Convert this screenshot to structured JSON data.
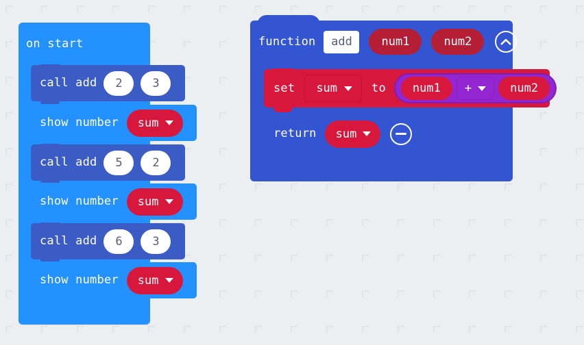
{
  "workspace": {
    "background_color": "#eceff1",
    "grid_mark_color": "#dde2e5"
  },
  "palette": {
    "event_blue": "#2391ff",
    "function_call_blue": "#3b5bc5",
    "function_def_blue": "#3455d1",
    "variable_red": "#d7183c",
    "parameter_dark_red": "#b41f35",
    "operator_purple": "#9326d1",
    "field_white": "#ffffff",
    "field_text": "#575e75"
  },
  "on_start_script": {
    "hat_label": "on start",
    "statements": [
      {
        "kind": "call",
        "label": "call add",
        "args": [
          "2",
          "3"
        ]
      },
      {
        "kind": "show",
        "label": "show number",
        "variable": "sum",
        "dropdown_icon": "chevron-down-icon"
      },
      {
        "kind": "call",
        "label": "call add",
        "args": [
          "5",
          "2"
        ]
      },
      {
        "kind": "show",
        "label": "show number",
        "variable": "sum",
        "dropdown_icon": "chevron-down-icon"
      },
      {
        "kind": "call",
        "label": "call add",
        "args": [
          "6",
          "3"
        ]
      },
      {
        "kind": "show",
        "label": "show number",
        "variable": "sum",
        "dropdown_icon": "chevron-down-icon"
      }
    ]
  },
  "function_definition": {
    "keyword": "function",
    "name": "add",
    "parameters": [
      "num1",
      "num2"
    ],
    "collapse_icon": "chevron-up-circle-icon",
    "body": {
      "set_statement": {
        "keyword": "set",
        "variable": "sum",
        "variable_dropdown_icon": "chevron-down-icon",
        "connector": "to",
        "expression": {
          "left_operand": "num1",
          "operator": "+",
          "operator_dropdown_icon": "chevron-down-icon",
          "right_operand": "num2"
        }
      },
      "return_statement": {
        "keyword": "return",
        "variable": "sum",
        "variable_dropdown_icon": "chevron-down-icon",
        "remove_icon": "minus-circle-icon"
      }
    }
  }
}
